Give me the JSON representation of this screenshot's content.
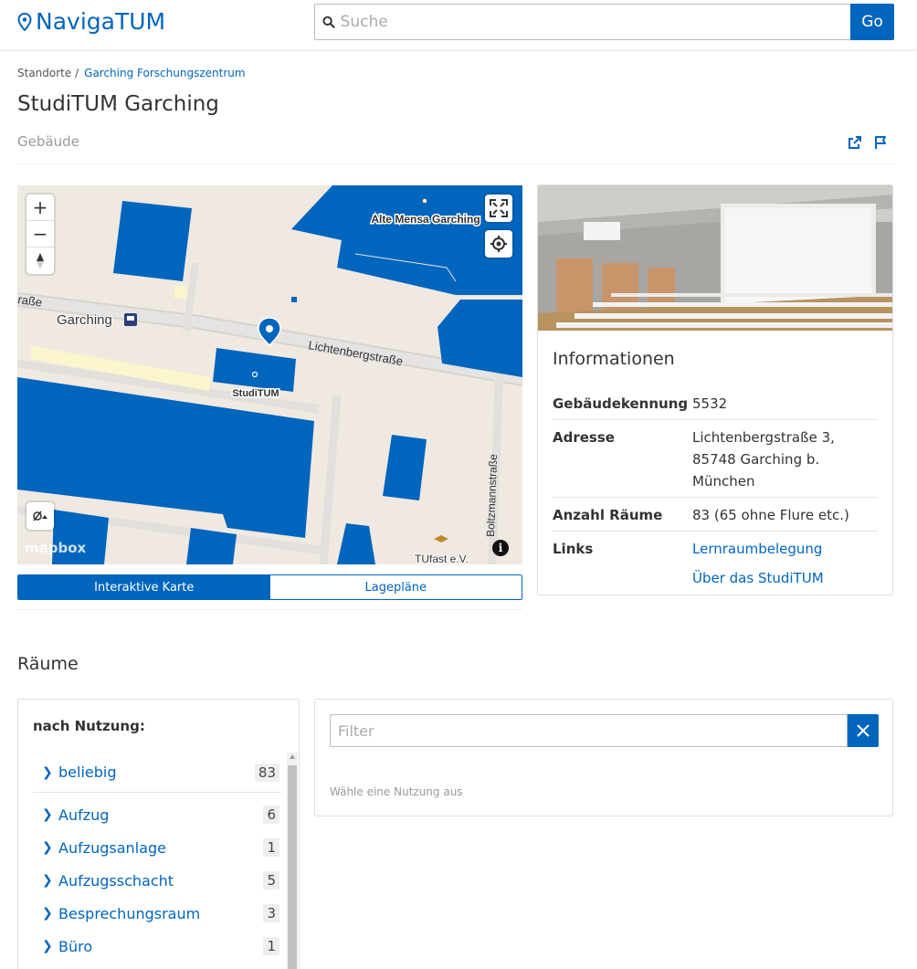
{
  "header": {
    "logo_text": "NavigaTUM",
    "search_placeholder": "Suche",
    "go_label": "Go"
  },
  "breadcrumb": {
    "root": "Standorte",
    "separator": "/",
    "link": "Garching Forschungszentrum"
  },
  "page": {
    "title": "StudiTUM Garching",
    "subtitle": "Gebäude"
  },
  "map": {
    "labels": {
      "alte_mensa": "Alte Mensa Garching",
      "street_lichtenberg": "Lichtenbergstraße",
      "street_left": "raße",
      "place_garching": "Garching",
      "studitum": "StudiTUM",
      "street_boltzmann": "Boltzmannstraße",
      "tufast": "TUfast e.V.",
      "mapbox": "mapbox"
    },
    "tabs": {
      "interactive": "Interaktive Karte",
      "plans": "Lagepläne"
    }
  },
  "info": {
    "title": "Informationen",
    "rows": [
      {
        "key": "Gebäudekennung",
        "value": "5532"
      },
      {
        "key": "Adresse",
        "value": "Lichtenbergstraße 3, 85748 Garching b. München"
      },
      {
        "key": "Anzahl Räume",
        "value": "83 (65 ohne Flure etc.)"
      }
    ],
    "links_key": "Links",
    "links": [
      "Lernraumbelegung",
      "Über das StudiTUM"
    ]
  },
  "rooms": {
    "title": "Räume",
    "usage_heading": "nach Nutzung:",
    "usages": [
      {
        "name": "beliebig",
        "count": "83"
      },
      {
        "name": "Aufzug",
        "count": "6"
      },
      {
        "name": "Aufzugsanlage",
        "count": "1"
      },
      {
        "name": "Aufzugsschacht",
        "count": "5"
      },
      {
        "name": "Besprechungsraum",
        "count": "3"
      },
      {
        "name": "Büro",
        "count": "1"
      }
    ],
    "filter_placeholder": "Filter",
    "filter_hint": "Wähle eine Nutzung aus"
  },
  "colors": {
    "accent": "#0065bd",
    "map_building": "#0065bd",
    "map_ground": "#efe9e1"
  }
}
